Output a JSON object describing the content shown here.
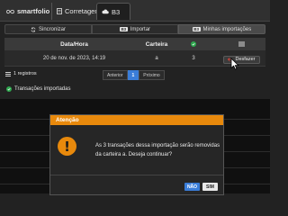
{
  "tabs": [
    {
      "label": "smartfolio",
      "icon": "infinity-icon"
    },
    {
      "label": "Corretagem",
      "icon": "document-icon"
    },
    {
      "label": "B3",
      "icon": "cloud-icon"
    }
  ],
  "subtabs": {
    "sync": {
      "label": "Sincronizar",
      "icon": "sync-icon"
    },
    "import": {
      "label": "Importar",
      "icon": "import-icon"
    },
    "mine": {
      "label": "Minhas importações",
      "icon": "list-icon"
    }
  },
  "table": {
    "headers": {
      "date": "Data/Hora",
      "wallet": "Carteira"
    },
    "rows": [
      {
        "date": "20 de nov. de 2023, 14:19",
        "wallet": "a",
        "count": "3",
        "action": "Desfazer"
      }
    ]
  },
  "records": "1 registros",
  "pager": {
    "prev": "Anterior",
    "page": "1",
    "next": "Próximo"
  },
  "imported_status": "Transações importadas",
  "modal": {
    "title": "Atenção",
    "message": "As 3 transações dessa importação serão removidas da carteira a. Deseja continuar?",
    "no": "NÃO",
    "yes": "SIM"
  },
  "colors": {
    "accent": "#e8890c",
    "primary": "#3a7dd8",
    "success": "#2fa84f",
    "danger": "#e0433a"
  }
}
